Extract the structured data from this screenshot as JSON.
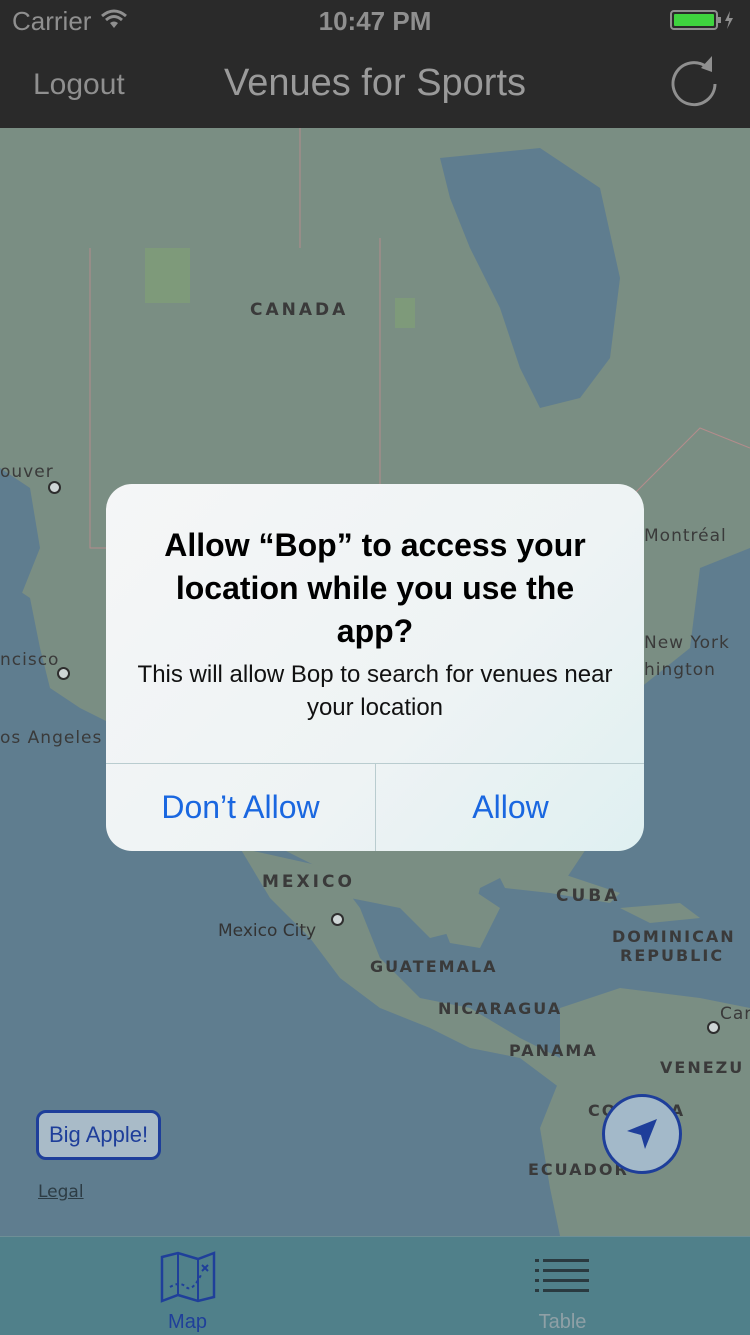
{
  "status": {
    "carrier": "Carrier",
    "time": "10:47 PM"
  },
  "nav": {
    "title": "Venues for Sports",
    "left_button": "Logout",
    "right_icon": "refresh-icon"
  },
  "map": {
    "labels": {
      "canada": "CANADA",
      "vancouver": "ouver",
      "san_francisco": "ncisco",
      "los_angeles": "os Angeles",
      "montreal": "Montréal",
      "new_york": "New York",
      "washington": "hington",
      "mexico": "MEXICO",
      "mexico_city": "Mexico City",
      "cuba": "CUBA",
      "dominican": "DOMINICAN",
      "republic": "REPUBLIC",
      "guatemala": "GUATEMALA",
      "nicaragua": "NICARAGUA",
      "panama": "PANAMA",
      "caracas": "Car",
      "venezuela": "VENEZU",
      "colombia": "CO      IA",
      "ecuador": "ECUADOR"
    },
    "pin_label": "Big Apple!",
    "legal": "Legal"
  },
  "alert": {
    "title": "Allow “Bop” to access your location while you use the app?",
    "message": "This will allow Bop to search for venues near your location",
    "deny": "Don’t Allow",
    "allow": "Allow"
  },
  "tabs": [
    {
      "label": "Map",
      "icon": "map-icon",
      "selected": true
    },
    {
      "label": "Table",
      "icon": "list-icon",
      "selected": false
    }
  ],
  "colors": {
    "tint": "#1e3e9a",
    "alert_button": "#1a67e0"
  }
}
